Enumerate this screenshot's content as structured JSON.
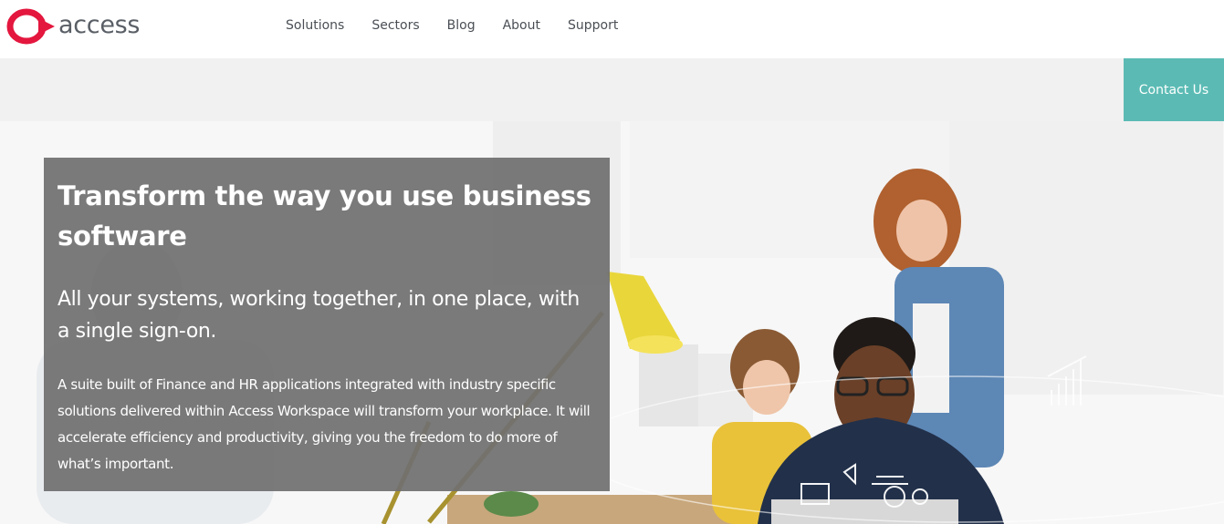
{
  "header": {
    "logo_text": "access",
    "nav": [
      "Solutions",
      "Sectors",
      "Blog",
      "About",
      "Support"
    ]
  },
  "contact_button": "Contact Us",
  "hero": {
    "title": "Transform the way you use business software",
    "subtitle": "All your systems, working together, in one place, with a single sign-on.",
    "body": "A suite built of Finance and HR applications integrated with industry specific solutions delivered within Access Workspace will transform your workplace. It will accelerate efficiency and productivity, giving you the freedom to do more of what’s important."
  },
  "colors": {
    "brand_red": "#e4173e",
    "accent_teal": "#5bbbb4",
    "overlay_grey": "#707070"
  },
  "icons": [
    "access-logo-icon",
    "megaphone-icon",
    "gear-icon",
    "lightbulb-icon",
    "chart-icon",
    "monitor-icon"
  ]
}
